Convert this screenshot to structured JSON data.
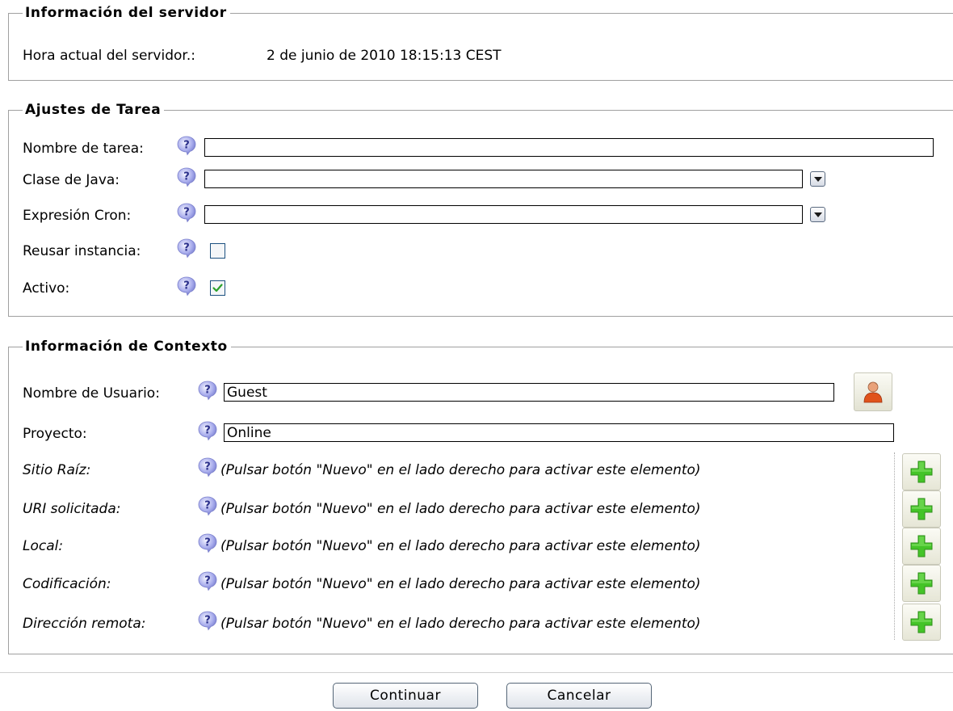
{
  "server_info": {
    "legend": "Información del servidor",
    "time_label": "Hora actual del servidor.:",
    "time_value": "2 de junio de 2010 18:15:13 CEST"
  },
  "task_settings": {
    "legend": "Ajustes de Tarea",
    "name_label": "Nombre de tarea:",
    "name_value": "",
    "java_class_label": "Clase de Java:",
    "java_class_value": "",
    "cron_label": "Expresión Cron:",
    "cron_value": "",
    "reuse_label": "Reusar instancia:",
    "reuse_checked": false,
    "active_label": "Activo:",
    "active_checked": true
  },
  "context_info": {
    "legend": "Información de Contexto",
    "username_label": "Nombre de Usuario:",
    "username_value": "Guest",
    "project_label": "Proyecto:",
    "project_value": "Online",
    "hint": "(Pulsar botón \"Nuevo\" en el lado derecho para activar este elemento)",
    "optional_rows": [
      {
        "label": "Sitio Raíz:",
        "hint": "(Pulsar botón \"Nuevo\" en el lado derecho para activar este elemento)"
      },
      {
        "label": "URI solicitada:",
        "hint": "(Pulsar botón \"Nuevo\" en el lado derecho para activar este elemento)"
      },
      {
        "label": "Local:",
        "hint": "(Pulsar botón \"Nuevo\" en el lado derecho para activar este elemento)"
      },
      {
        "label": "Codificación:",
        "hint": "(Pulsar botón \"Nuevo\" en el lado derecho para activar este elemento)"
      },
      {
        "label": "Dirección remota:",
        "hint": "(Pulsar botón \"Nuevo\" en el lado derecho para activar este elemento)"
      }
    ]
  },
  "actions": {
    "continue_label": "Continuar",
    "cancel_label": "Cancelar"
  },
  "icons": {
    "help": "help-question-icon",
    "dropdown": "chevron-down-icon",
    "user": "user-icon",
    "add": "plus-icon"
  },
  "colors": {
    "help_bubble": "#8a8fd8",
    "add_green": "#3cbf22",
    "checkbox_border": "#1c5180",
    "check_mark": "#2aa02a"
  }
}
